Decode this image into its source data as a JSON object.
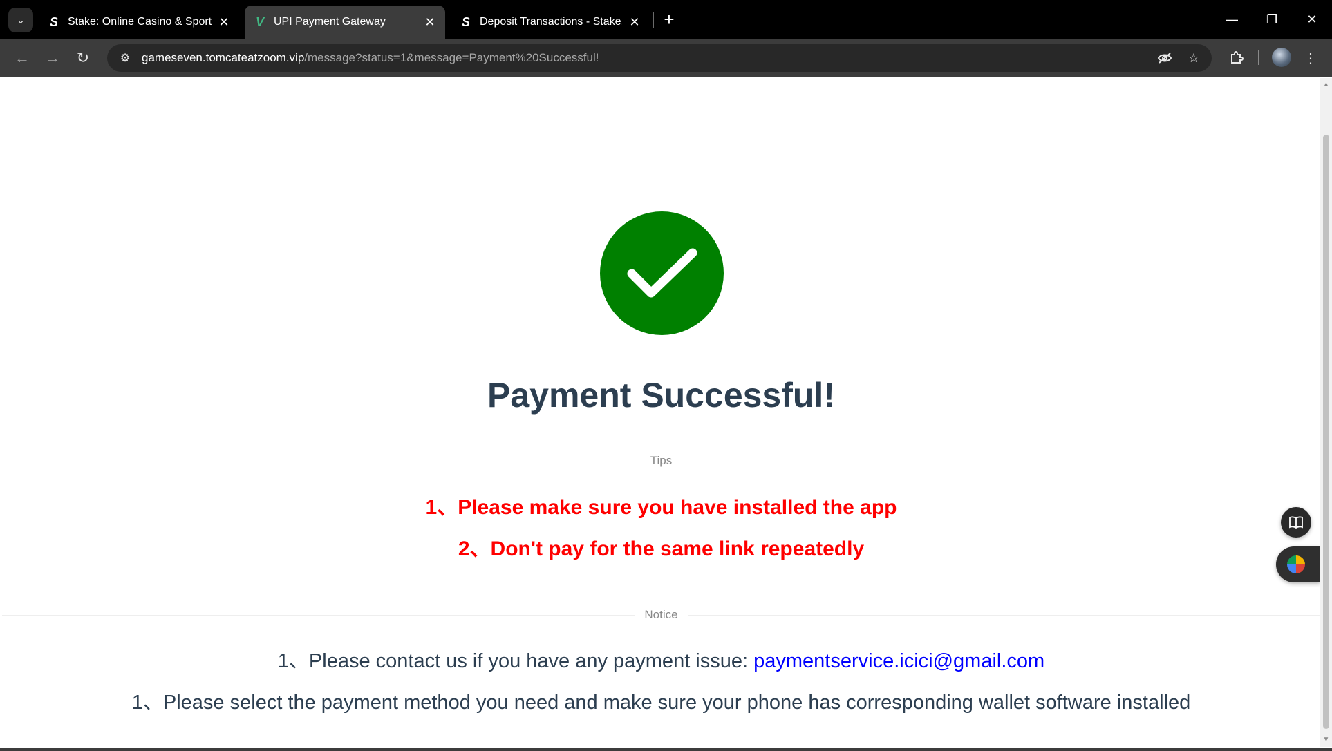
{
  "browser": {
    "tabs": [
      {
        "title": "Stake: Online Casino & Sports B",
        "favicon": "S",
        "active": false
      },
      {
        "title": "UPI Payment Gateway",
        "favicon": "V",
        "active": true
      },
      {
        "title": "Deposit Transactions - Stake.co",
        "favicon": "S",
        "active": false
      }
    ],
    "new_tab_symbol": "+",
    "url_host": "gameseven.tomcateatzoom.vip",
    "url_path": "/message?status=1&message=Payment%20Successful!"
  },
  "icons": {
    "tab_search": "chevron-down-icon",
    "back": "back-arrow-icon",
    "forward": "forward-arrow-icon",
    "reload": "reload-icon",
    "site_info": "tune-icon",
    "eye_off": "eye-off-icon",
    "bookmark": "star-icon",
    "extensions": "puzzle-icon",
    "menu": "kebab-menu-icon"
  },
  "page": {
    "headline": "Payment Successful!",
    "tips_label": "Tips",
    "tips": [
      "1、Please make sure you have installed the app",
      "2、Don't pay for the same link repeatedly"
    ],
    "notice_label": "Notice",
    "notice_contact_prefix": "1、Please contact us if you have any payment issue: ",
    "notice_contact_email": "paymentservice.icici@gmail.com",
    "notice_second": "1、Please select the payment method you need and make sure your phone has corresponding wallet software installed"
  },
  "colors": {
    "success_green": "#008000",
    "tip_red": "#ff0000",
    "headline_text": "#2c3e50",
    "link_blue": "#0000ff"
  }
}
